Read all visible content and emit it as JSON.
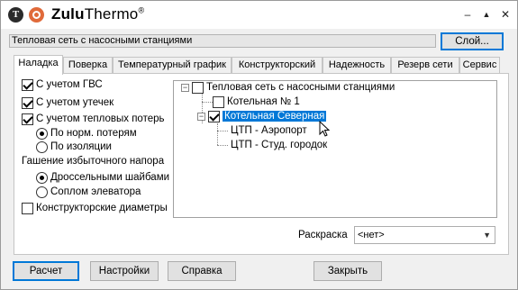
{
  "window": {
    "logo_letter": "T",
    "title_bold": "Zulu",
    "title_rest": "Thermo",
    "title_mark": "®",
    "minimize_icon": "–",
    "maximize_icon": "▲",
    "close_icon": "✕"
  },
  "path_field": {
    "value": "Тепловая сеть с насосными станциями"
  },
  "layer_button": {
    "label": "Слой..."
  },
  "tabs": [
    {
      "label": "Наладка",
      "active": true
    },
    {
      "label": "Поверка"
    },
    {
      "label": "Температурный график"
    },
    {
      "label": "Конструкторский"
    },
    {
      "label": "Надежность"
    },
    {
      "label": "Резерв сети"
    },
    {
      "label": "Сервис"
    }
  ],
  "options": {
    "gvs": {
      "label": "С учетом ГВС",
      "checked": true
    },
    "leaks": {
      "label": "С учетом утечек",
      "checked": true
    },
    "heat_loss": {
      "label": "С учетом тепловых потерь",
      "checked": true
    },
    "norm_losses": {
      "label": "По норм. потерям",
      "selected": true
    },
    "insulation": {
      "label": "По изоляции",
      "selected": false
    },
    "head_group_label": "Гашение избыточного напора",
    "throttle": {
      "label": "Дроссельными шайбами",
      "selected": true
    },
    "nozzle": {
      "label": "Соплом элеватора",
      "selected": false
    },
    "design_diam": {
      "label": "Конструкторские диаметры",
      "checked": false
    }
  },
  "tree": {
    "root": "Тепловая сеть с насосными станциями",
    "boiler1": "Котельная № 1",
    "boiler_north": "Котельная Северная",
    "ctp1": "ЦТП - Аэропорт",
    "ctp2": "ЦТП - Студ. городок"
  },
  "coloring": {
    "label": "Раскраска",
    "value": "<нет>"
  },
  "buttons": {
    "calc": "Расчет",
    "settings": "Настройки",
    "help": "Справка",
    "close": "Закрыть"
  }
}
